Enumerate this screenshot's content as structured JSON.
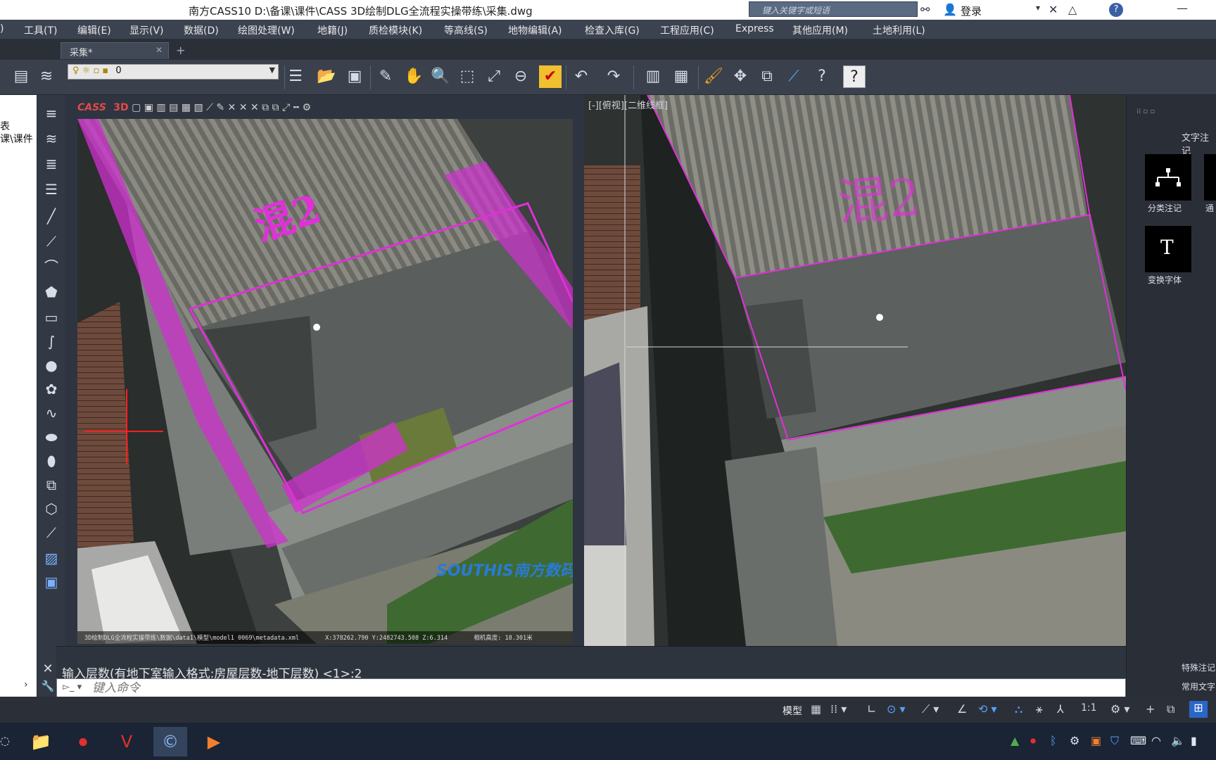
{
  "window": {
    "title": "南方CASS10    D:\\备课\\课件\\CASS 3D绘制DLG全流程实操带练\\采集.dwg",
    "search_placeholder": "键入关键字或短语",
    "login_label": "登录"
  },
  "menu": {
    "items": [
      "工具(T)",
      "编辑(E)",
      "显示(V)",
      "数据(D)",
      "绘图处理(W)",
      "地籍(J)",
      "质检模块(K)",
      "等高线(S)",
      "地物编辑(A)",
      "检查入库(G)",
      "工程应用(C)",
      "Express",
      "其他应用(M)",
      "土地利用(L)"
    ]
  },
  "tabs": {
    "active": "采集*",
    "add_label": "+"
  },
  "toolbar": {
    "layer_value": "0"
  },
  "left_panel": {
    "text1": "表",
    "text2": "课\\课件"
  },
  "viewport_left": {
    "brand": "CASS",
    "mode": "3D",
    "map_label": "混2",
    "status_path": "3D绘制DLG全流程实操带练\\数据\\data1\\模型\\model1 0069\\metadata.xml",
    "status_coords": "X:378262.790  Y:2482743.508  Z:6.314",
    "status_camera": "相机高度: 18.301米",
    "watermark": "SOUTHIS南方数码"
  },
  "viewport_right": {
    "label": "[-][俯视][二维线框]",
    "map_label": "混2"
  },
  "right_panel": {
    "header": "文字注记",
    "tools": [
      {
        "label": "分类注记",
        "icon": "hierarchy-icon"
      },
      {
        "label": "变换字体",
        "icon": "text-T-icon"
      }
    ],
    "truncated": "通",
    "bottom1": "特殊注记",
    "bottom2": "常用文字"
  },
  "command": {
    "history": "输入层数(有地下室输入格式:房屋层数-地下层数) <1>:2",
    "input_placeholder": "键入命令"
  },
  "statusbar": {
    "model_label": "模型",
    "scale": "1:1"
  },
  "colors": {
    "magenta": "#e030d8",
    "crosshair_red": "#ff2020",
    "accent_blue": "#3a7bd5"
  }
}
